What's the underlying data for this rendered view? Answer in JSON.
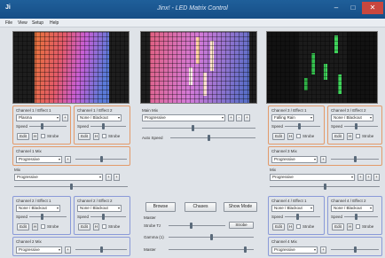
{
  "window": {
    "title": "Jinx! - LED Matrix Control",
    "app_icon": "Ji",
    "min_glyph": "–",
    "max_glyph": "□",
    "close_glyph": "✕"
  },
  "menu": [
    "File",
    "View",
    "Setup",
    "Help"
  ],
  "common": {
    "speed": "Speed",
    "edit": "Edit",
    "h": "H",
    "strobe": "Strobe",
    "dd_arrow": "▾",
    "plus": "+"
  },
  "channels": {
    "c1": {
      "title": "Channel 1 / Effect 1",
      "value": "Plasma",
      "speed_level": 0.35
    },
    "c1b": {
      "title": "Channel 1 / Effect 2",
      "value": "None / Blackout",
      "speed_level": 0.35
    },
    "c2": {
      "title": "Channel 2 / Effect 1",
      "value": "None / Blackout",
      "speed_level": 0.35
    },
    "c2b": {
      "title": "Channel 2 / Effect 2",
      "value": "None / Blackout",
      "speed_level": 0.35
    },
    "c3": {
      "title": "Channel 3 / Effect 1",
      "value": "Falling Rain",
      "speed_level": 0.4
    },
    "c3b": {
      "title": "Channel 3 / Effect 2",
      "value": "None / Blackout",
      "speed_level": 0.35
    },
    "c4": {
      "title": "Channel 4 / Effect 1",
      "value": "None / Blackout",
      "speed_level": 0.35
    },
    "c4b": {
      "title": "Channel 4 / Effect 2",
      "value": "None / Blackout",
      "speed_level": 0.35
    }
  },
  "mixes": {
    "ch1": {
      "title": "Channel 1 Mix",
      "value": "Progressive",
      "level": 0.5
    },
    "ch2": {
      "title": "Channel 2 Mix",
      "value": "Progressive",
      "level": 0.5
    },
    "ch3": {
      "title": "Channel 3 Mix",
      "value": "Progressive",
      "level": 0.5
    },
    "ch4": {
      "title": "Channel 4 Mix",
      "value": "Progressive",
      "level": 0.5
    },
    "left": {
      "title": "Mix",
      "value": "Progressive",
      "level": 0.5
    },
    "right": {
      "title": "Mix",
      "value": "Progressive",
      "level": 0.5
    }
  },
  "main_mix": {
    "title": "Main Mix",
    "value": "Progressive",
    "b1": "+",
    "b2": "-",
    "b3": "+",
    "auto_speed": "Auto Speed",
    "auto_level": 0.45
  },
  "center": {
    "browse": "Browse",
    "chases": "Chases",
    "show_mode": "Show Mode",
    "master": "Master",
    "strobe_tz": "Strobe Tz",
    "strobe_btn": "Strobe",
    "gamma": "Gamma (1)",
    "master2": "Master",
    "strobe_level": 0.4,
    "gamma_level": 0.5,
    "master_level": 0.9
  }
}
